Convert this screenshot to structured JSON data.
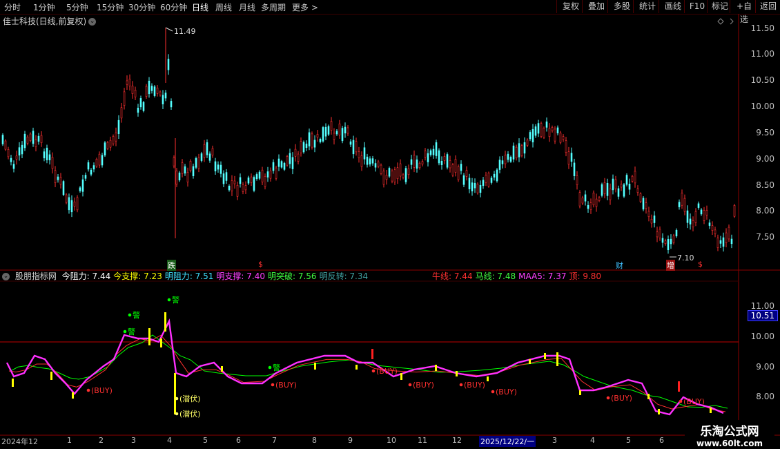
{
  "toolbar": {
    "periods": [
      "分时",
      "1分钟",
      "5分钟",
      "15分钟",
      "30分钟",
      "60分钟",
      "日线",
      "周线",
      "月线",
      "多周期",
      "更多 >"
    ],
    "active": "日线",
    "right_buttons": [
      "复权",
      "叠加",
      "多股",
      "统计",
      "画线",
      "F10",
      "标记",
      "+自选",
      "返回"
    ]
  },
  "main": {
    "title": "佳士科技(日线,前复权)",
    "high_label": "11.49",
    "low_label": "7.10",
    "y_ticks": [
      "11.50",
      "11.00",
      "10.50",
      "10.00",
      "9.50",
      "9.00",
      "8.50",
      "8.00",
      "7.50"
    ],
    "event_tags": [
      {
        "text": "跌",
        "color": "#ffffff",
        "bg": "#1a5c1a"
      },
      {
        "text": "$",
        "color": "#ff3030"
      },
      {
        "text": "财",
        "color": "#40c0ff"
      },
      {
        "text": "增",
        "color": "#ffffff",
        "bg": "#9a1010"
      },
      {
        "text": "$",
        "color": "#ff3030"
      }
    ]
  },
  "indicator": {
    "name": "股朋指标网",
    "items": [
      {
        "label": "今阻力:",
        "value": "7.44",
        "color": "#ffffff"
      },
      {
        "label": "今支撑:",
        "value": "7.23",
        "color": "#ffff00"
      },
      {
        "label": "明阻力:",
        "value": "7.51",
        "color": "#40e0ff"
      },
      {
        "label": "明支撑:",
        "value": "7.40",
        "color": "#ff40ff"
      },
      {
        "label": "明突破:",
        "value": "7.56",
        "color": "#40ff40"
      },
      {
        "label": "明反转:",
        "value": "7.34",
        "color": "#40a0a0"
      }
    ],
    "items_right": [
      {
        "label": "牛线:",
        "value": "7.44",
        "color": "#ff3030"
      },
      {
        "label": "马线:",
        "value": "7.48",
        "color": "#40ff40"
      },
      {
        "label": "MAA5:",
        "value": "7.37",
        "color": "#ff40ff"
      },
      {
        "label": "顶:",
        "value": "9.80",
        "color": "#ff3030"
      }
    ],
    "y_ticks": [
      "11.00",
      "10.51",
      "10.00",
      "9.00",
      "8.00"
    ],
    "current_value": "10.51",
    "signals": {
      "buy": "(BUY)",
      "alert": "警",
      "lurk": "(潜伏)"
    }
  },
  "dates": [
    "2024年12",
    "1",
    "2",
    "3",
    "4",
    "5",
    "6",
    "7",
    "8",
    "9",
    "10",
    "11",
    "12",
    "2025/12/22/一",
    "3",
    "4",
    "5",
    "6"
  ],
  "watermark": {
    "title": "乐淘公式网",
    "url": "www.60lt.com"
  },
  "colors": {
    "up": "#ff3030",
    "down": "#54ffff",
    "grid": "#8b0000",
    "magenta": "#ff30ff",
    "green": "#00ff00",
    "yellow": "#ffff00",
    "red_line": "#c00000"
  }
}
